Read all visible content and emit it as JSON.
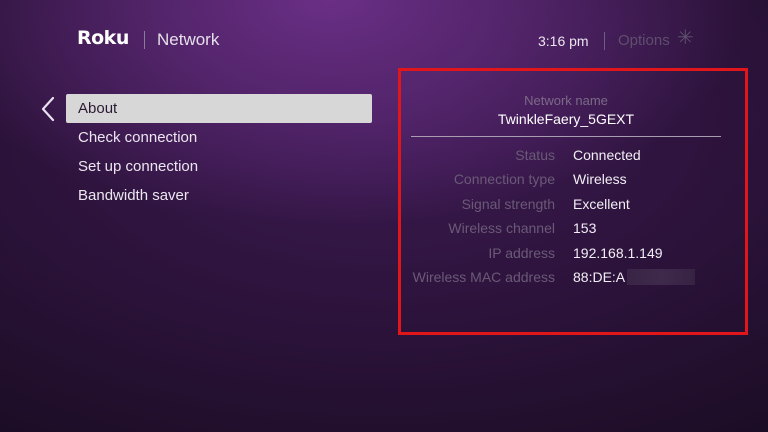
{
  "header": {
    "logo": "Roku",
    "title": "Network",
    "time": "3:16  pm",
    "options_label": "Options",
    "options_icon": "asterisk-icon"
  },
  "menu": {
    "back_icon": "chevron-left-icon",
    "items": [
      {
        "label": "About",
        "selected": true
      },
      {
        "label": "Check connection",
        "selected": false
      },
      {
        "label": "Set up connection",
        "selected": false
      },
      {
        "label": "Bandwidth saver",
        "selected": false
      }
    ]
  },
  "info": {
    "network_name_label": "Network name",
    "network_name": "TwinkleFaery_5GEXT",
    "rows": [
      {
        "key": "Status",
        "value": "Connected"
      },
      {
        "key": "Connection type",
        "value": "Wireless"
      },
      {
        "key": "Signal strength",
        "value": "Excellent"
      },
      {
        "key": "Wireless channel",
        "value": "153"
      },
      {
        "key": "IP address",
        "value": "192.168.1.149"
      },
      {
        "key": "Wireless MAC address",
        "value": "88:DE:A"
      }
    ]
  },
  "colors": {
    "highlight_border": "#e0161b",
    "selected_item_bg": "#d7d7d7",
    "background": "#2a1238"
  }
}
